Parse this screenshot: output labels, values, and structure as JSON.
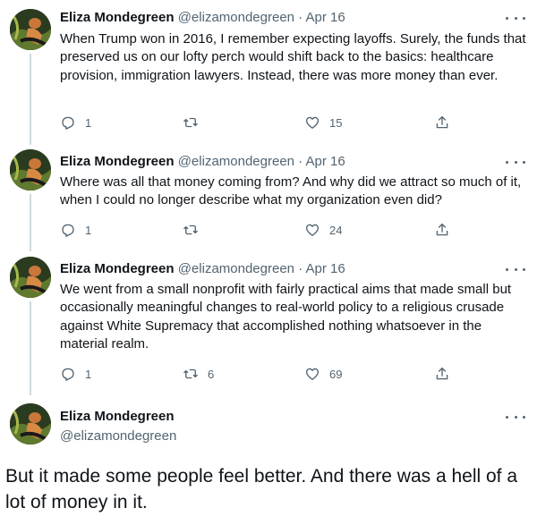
{
  "author": {
    "name": "Eliza Mondegreen",
    "handle": "@elizamondegreen",
    "separator": "·"
  },
  "tweets": [
    {
      "date": "Apr 16",
      "text": "When Trump won in 2016, I remember expecting layoffs. Surely, the funds that preserved us on our lofty perch would shift back to the basics: healthcare provision, immigration lawyers. Instead, there was more money than ever.",
      "replies": "1",
      "retweets": "",
      "likes": "15"
    },
    {
      "date": "Apr 16",
      "text": "Where was all that money coming from? And why did we attract so much of it, when I could no longer describe what my organization even did?",
      "replies": "1",
      "retweets": "",
      "likes": "24"
    },
    {
      "date": "Apr 16",
      "text": "We went from a small nonprofit with fairly practical aims that made small but occasionally meaningful changes to real-world policy to a religious crusade against White Supremacy that accomplished nothing whatsoever in the material realm.",
      "replies": "1",
      "retweets": "6",
      "likes": "69"
    }
  ],
  "focused_tweet": {
    "text": "But it made some people feel better. And there was a hell of a lot of money in it."
  },
  "icons": {
    "reply": "reply-icon",
    "retweet": "retweet-icon",
    "like": "heart-icon",
    "share": "share-icon",
    "more": "more-icon"
  },
  "colors": {
    "text": "#0f1419",
    "secondary": "#536471",
    "thread_line": "#cfd9de"
  }
}
